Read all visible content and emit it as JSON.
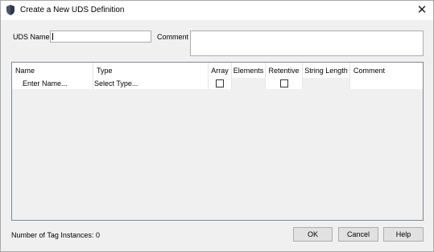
{
  "dialog": {
    "title": "Create a New UDS Definition",
    "close_glyph": "✕"
  },
  "form": {
    "uds_name_label": "UDS Name",
    "uds_name_value": "",
    "comment_label": "Comment",
    "comment_value": ""
  },
  "grid": {
    "columns": [
      "Name",
      "Type",
      "Array",
      "Elements",
      "Retentive",
      "String Length",
      "Comment"
    ],
    "row": {
      "name": "Enter Name...",
      "type": "Select Type...",
      "array_checked": false,
      "elements": "",
      "retentive_checked": false,
      "string_length": "",
      "comment": ""
    }
  },
  "footer": {
    "tag_instances_label": "Number of Tag Instances:",
    "tag_instances_count": "0",
    "ok_label": "OK",
    "cancel_label": "Cancel",
    "help_label": "Help"
  },
  "colors": {
    "window_bg": "#f0f0f0",
    "titlebar_bg": "#ffffff",
    "button_bg": "#e1e1e1",
    "border": "#adadad"
  }
}
